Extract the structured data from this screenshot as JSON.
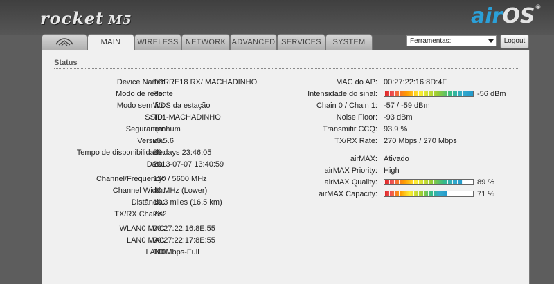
{
  "brand": {
    "product": "rocket",
    "model": "M5",
    "os_prefix": "air",
    "os_suffix": "OS",
    "os_mark": "®"
  },
  "tabs": [
    {
      "label": ""
    },
    {
      "label": "MAIN"
    },
    {
      "label": "WIRELESS"
    },
    {
      "label": "NETWORK"
    },
    {
      "label": "ADVANCED"
    },
    {
      "label": "SERVICES"
    },
    {
      "label": "SYSTEM"
    }
  ],
  "active_tab": 1,
  "tools": {
    "selected": "Ferramentas:",
    "logout_label": "Logout"
  },
  "status": {
    "title": "Status",
    "left": [
      {
        "label": "Device Name:",
        "value": "TORRE18 RX/ MACHADINHO"
      },
      {
        "label": "Modo de rede:",
        "value": "Ponte"
      },
      {
        "label": "Modo sem fio:",
        "value": "WDS da estação"
      },
      {
        "label": "SSID:",
        "value": "T01-MACHADINHO"
      },
      {
        "label": "Segurança:",
        "value": "nenhum"
      },
      {
        "label": "Version:",
        "value": "v5.5.6"
      },
      {
        "label": "Tempo de disponibilidade:",
        "value": "39 days 23:46:05"
      },
      {
        "label": "Data:",
        "value": "2013-07-07 13:40:59"
      },
      {
        "label": "Channel/Frequency:",
        "value": "120 / 5600 MHz"
      },
      {
        "label": "Channel Width:",
        "value": "40 MHz (Lower)"
      },
      {
        "label": "Distância:",
        "value": "10.3 miles (16.5 km)"
      },
      {
        "label": "TX/RX Chains:",
        "value": "2X2"
      },
      {
        "label": "WLAN0 MAC",
        "value": "00:27:22:16:8E:55"
      },
      {
        "label": "LAN0 MAC",
        "value": "00:27:22:17:8E:55"
      },
      {
        "label": "LAN0",
        "value": "100Mbps-Full"
      }
    ],
    "right": [
      {
        "label": "MAC do AP:",
        "value": "00:27:22:16:8D:4F"
      },
      {
        "label": "Intensidade do sinal:",
        "value": "-56 dBm",
        "bar": 1.0
      },
      {
        "label": "Chain 0 / Chain 1:",
        "value": "-57 / -59 dBm"
      },
      {
        "label": "Noise Floor:",
        "value": "-93 dBm"
      },
      {
        "label": "Transmitir CCQ:",
        "value": "93.9 %"
      },
      {
        "label": "TX/RX Rate:",
        "value": "270 Mbps / 270 Mbps"
      },
      {
        "label": "airMAX:",
        "value": "Ativado"
      },
      {
        "label": "airMAX Priority:",
        "value": "High"
      },
      {
        "label": "airMAX Quality:",
        "value": "89 %",
        "bar": 0.89
      },
      {
        "label": "airMAX Capacity:",
        "value": "71 %",
        "bar": 0.71
      }
    ]
  }
}
